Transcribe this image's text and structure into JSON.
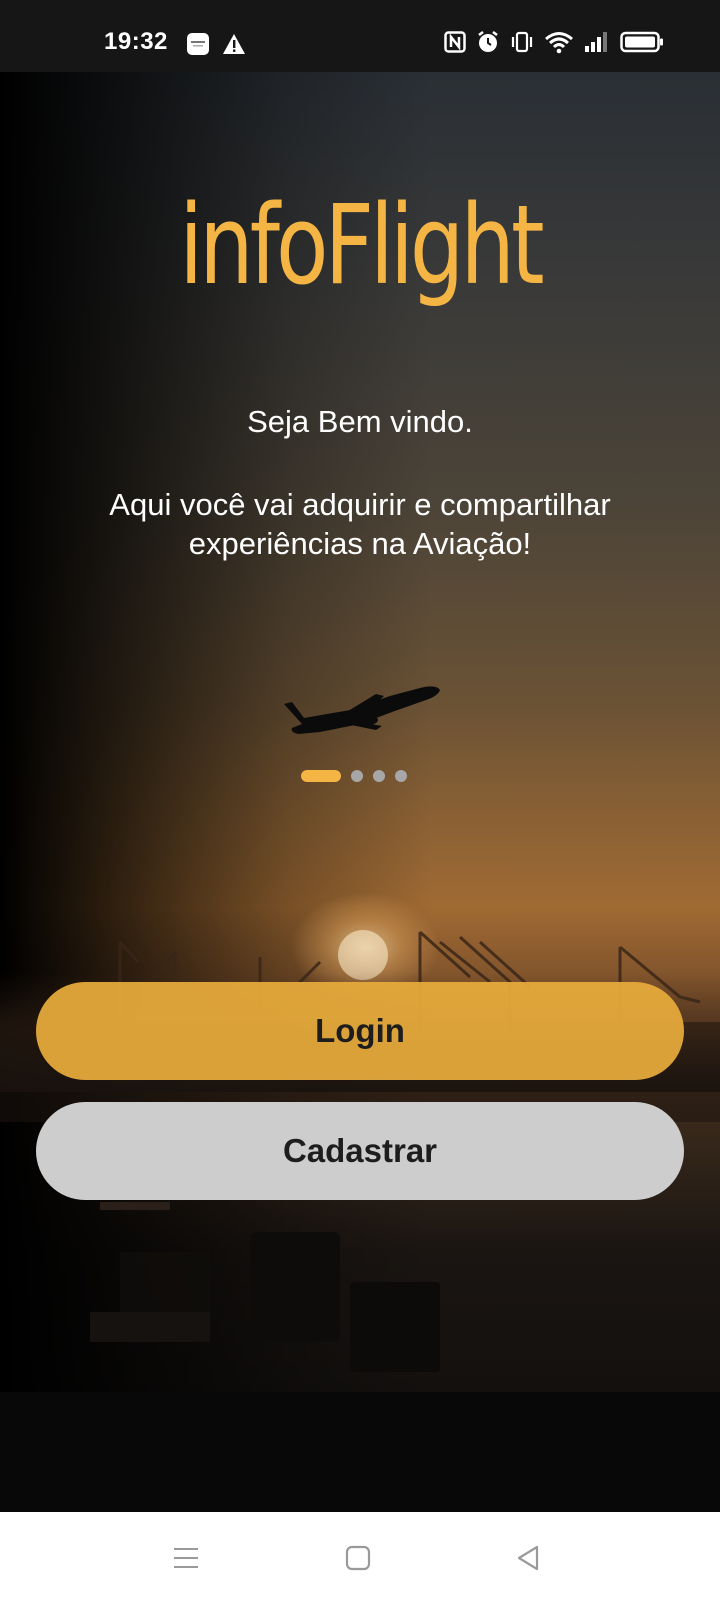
{
  "status_bar": {
    "time": "19:32",
    "left_icons": [
      "app-notification-icon",
      "warning-icon"
    ],
    "right_icons": [
      "nfc-icon",
      "alarm-icon",
      "vibrate-icon",
      "wifi-icon",
      "signal-icon",
      "battery-icon"
    ]
  },
  "main": {
    "logo": "infoFlight",
    "welcome": "Seja Bem vindo.",
    "tagline": "Aqui você vai adquirir e compartilhar experiências na Aviação!",
    "carousel": {
      "total_pages": 4,
      "active_page": 1
    },
    "buttons": {
      "login_label": "Login",
      "signup_label": "Cadastrar"
    }
  },
  "nav_bar": {
    "items": [
      "menu-icon",
      "home-icon",
      "back-icon"
    ]
  },
  "colors": {
    "accent": "#f4b544",
    "login_button": "#e6aa3c",
    "signup_button": "#cdcdcd",
    "text": "#ffffff"
  }
}
